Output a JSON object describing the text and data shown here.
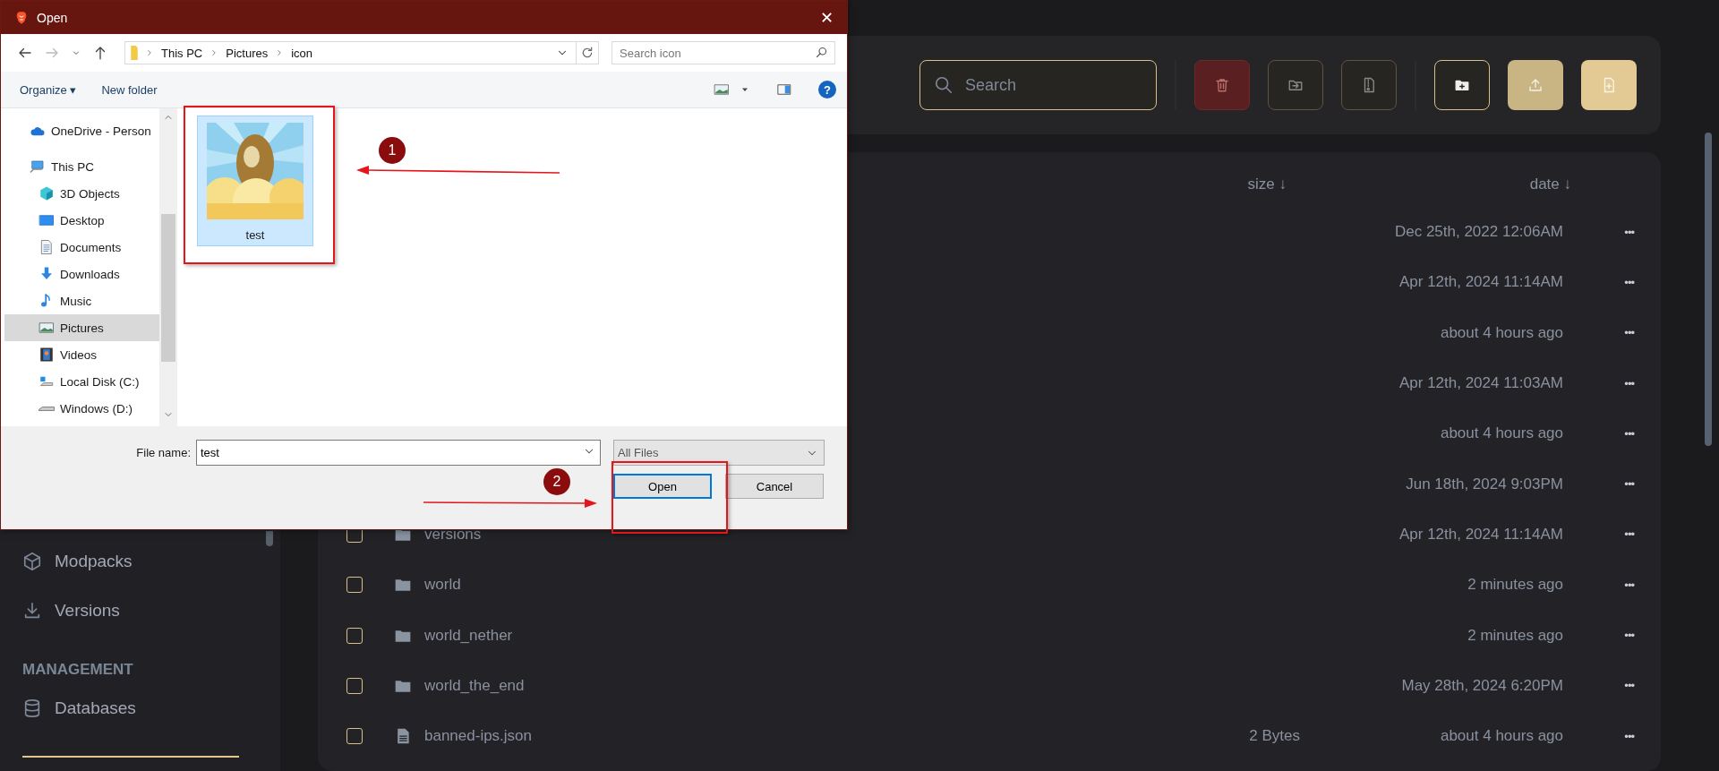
{
  "app": {
    "sidebar": {
      "items": [
        {
          "kind": "cube",
          "label": "Modpacks"
        },
        {
          "kind": "download",
          "label": "Versions"
        },
        {
          "kind": "heading",
          "label": "MANAGEMENT"
        },
        {
          "kind": "database",
          "label": "Databases"
        }
      ]
    },
    "toolbar": {
      "search": {
        "placeholder": "Search"
      },
      "button_groups": [
        {
          "buttons": [
            {
              "kind": "delete"
            },
            {
              "kind": "move"
            },
            {
              "kind": "archive"
            }
          ]
        },
        {
          "buttons": [
            {
              "kind": "new-folder"
            },
            {
              "kind": "upload"
            },
            {
              "kind": "new-file"
            }
          ]
        }
      ]
    },
    "table": {
      "columns": [
        {
          "label": "size ↓"
        },
        {
          "label": "date ↓"
        }
      ],
      "rows": [
        {
          "date": "Dec 25th, 2022 12:06AM",
          "menu": "•••"
        },
        {
          "date": "Apr 12th, 2024 11:14AM",
          "menu": "•••"
        },
        {
          "date": "about 4 hours ago",
          "menu": "•••"
        },
        {
          "date": "Apr 12th, 2024 11:03AM",
          "menu": "•••"
        },
        {
          "date": "about 4 hours ago",
          "menu": "•••"
        },
        {
          "date": "Jun 18th, 2024 9:03PM",
          "menu": "•••"
        },
        {
          "kind": "folder",
          "checked": false,
          "name": "versions",
          "date": "Apr 12th, 2024 11:14AM",
          "menu": "•••"
        },
        {
          "kind": "folder",
          "checked": false,
          "name": "world",
          "date": "2 minutes ago",
          "menu": "•••"
        },
        {
          "kind": "folder",
          "checked": false,
          "name": "world_nether",
          "date": "2 minutes ago",
          "menu": "•••"
        },
        {
          "kind": "folder",
          "checked": false,
          "name": "world_the_end",
          "date": "May 28th, 2024 6:20PM",
          "menu": "•••"
        },
        {
          "kind": "file",
          "checked": false,
          "name": "banned-ips.json",
          "size": "2 Bytes",
          "date": "about 4 hours ago",
          "menu": "•••"
        }
      ]
    }
  },
  "dialog": {
    "title": "Open",
    "close": "✕",
    "breadcrumb": [
      "This PC",
      "Pictures",
      "icon"
    ],
    "search": {
      "placeholder": "Search icon"
    },
    "commands": [
      {
        "label": "Organize ▾"
      },
      {
        "label": "New folder"
      }
    ],
    "help": "?",
    "nav": [
      {
        "kind": "cloud",
        "label": "OneDrive - Person",
        "selected": false
      },
      {
        "kind": "computer",
        "label": "This PC",
        "selected": false,
        "children": [
          {
            "kind": "cube",
            "label": "3D Objects",
            "selected": false
          },
          {
            "kind": "desktop",
            "label": "Desktop",
            "selected": false
          },
          {
            "kind": "document",
            "label": "Documents",
            "selected": false
          },
          {
            "kind": "download",
            "label": "Downloads",
            "selected": false
          },
          {
            "kind": "music",
            "label": "Music",
            "selected": false
          },
          {
            "kind": "pictures",
            "label": "Pictures",
            "selected": true
          },
          {
            "kind": "videos",
            "label": "Videos",
            "selected": false
          },
          {
            "kind": "drive-windows",
            "label": "Local Disk (C:)",
            "selected": false
          },
          {
            "kind": "drive",
            "label": "Windows (D:)",
            "selected": false
          }
        ]
      }
    ],
    "files": [
      {
        "kind": "picture",
        "name": "test",
        "selected": true
      }
    ],
    "file_name": {
      "label": "File name:",
      "value": "test"
    },
    "file_type": {
      "value": "All Files"
    },
    "buttons": [
      {
        "label": "Open",
        "focused": true
      },
      {
        "label": "Cancel",
        "focused": false
      }
    ]
  },
  "annotations": [
    {
      "number": "1"
    },
    {
      "number": "2"
    }
  ]
}
